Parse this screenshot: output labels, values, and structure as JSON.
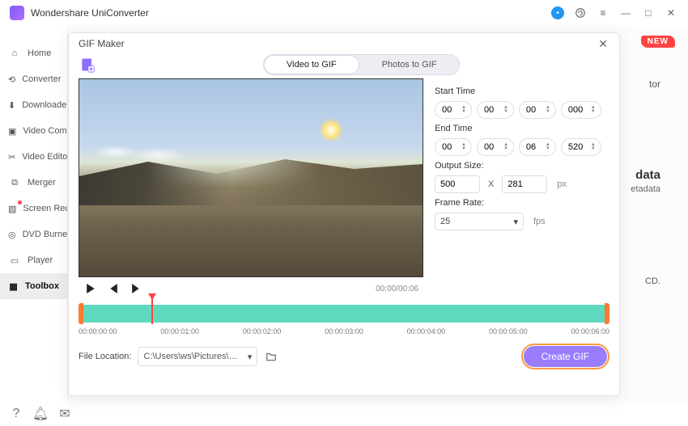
{
  "app": {
    "title": "Wondershare UniConverter"
  },
  "window_controls": {
    "min": "—",
    "max": "□",
    "close": "✕"
  },
  "sidebar": {
    "items": [
      {
        "label": "Home"
      },
      {
        "label": "Converter"
      },
      {
        "label": "Downloader"
      },
      {
        "label": "Video Compressor"
      },
      {
        "label": "Video Editor"
      },
      {
        "label": "Merger"
      },
      {
        "label": "Screen Recorder"
      },
      {
        "label": "DVD Burner"
      },
      {
        "label": "Player"
      },
      {
        "label": "Toolbox"
      }
    ]
  },
  "background": {
    "new_badge": "NEW",
    "text1": "tor",
    "text2": "data",
    "text3": "etadata",
    "text4": "CD."
  },
  "modal": {
    "title": "GIF Maker",
    "tabs": {
      "video": "Video to GIF",
      "photos": "Photos to GIF"
    },
    "playback": {
      "time_display": "00:00/00:06"
    },
    "settings": {
      "start_label": "Start Time",
      "start": {
        "h": "00",
        "m": "00",
        "s": "00",
        "ms": "000"
      },
      "end_label": "End Time",
      "end": {
        "h": "00",
        "m": "00",
        "s": "06",
        "ms": "520"
      },
      "size_label": "Output Size:",
      "size": {
        "w": "500",
        "h": "281",
        "sep": "X",
        "unit": "px"
      },
      "frame_label": "Frame Rate:",
      "frame": {
        "value": "25",
        "unit": "fps"
      }
    },
    "timeline": {
      "ticks": [
        "00:00:00:00",
        "00:00:01:00",
        "00:00:02:00",
        "00:00:03:00",
        "00:00:04:00",
        "00:00:05:00",
        "00:00:06:00"
      ]
    },
    "footer": {
      "loc_label": "File Location:",
      "loc_value": "C:\\Users\\ws\\Pictures\\Wonders",
      "create_label": "Create GIF"
    }
  }
}
